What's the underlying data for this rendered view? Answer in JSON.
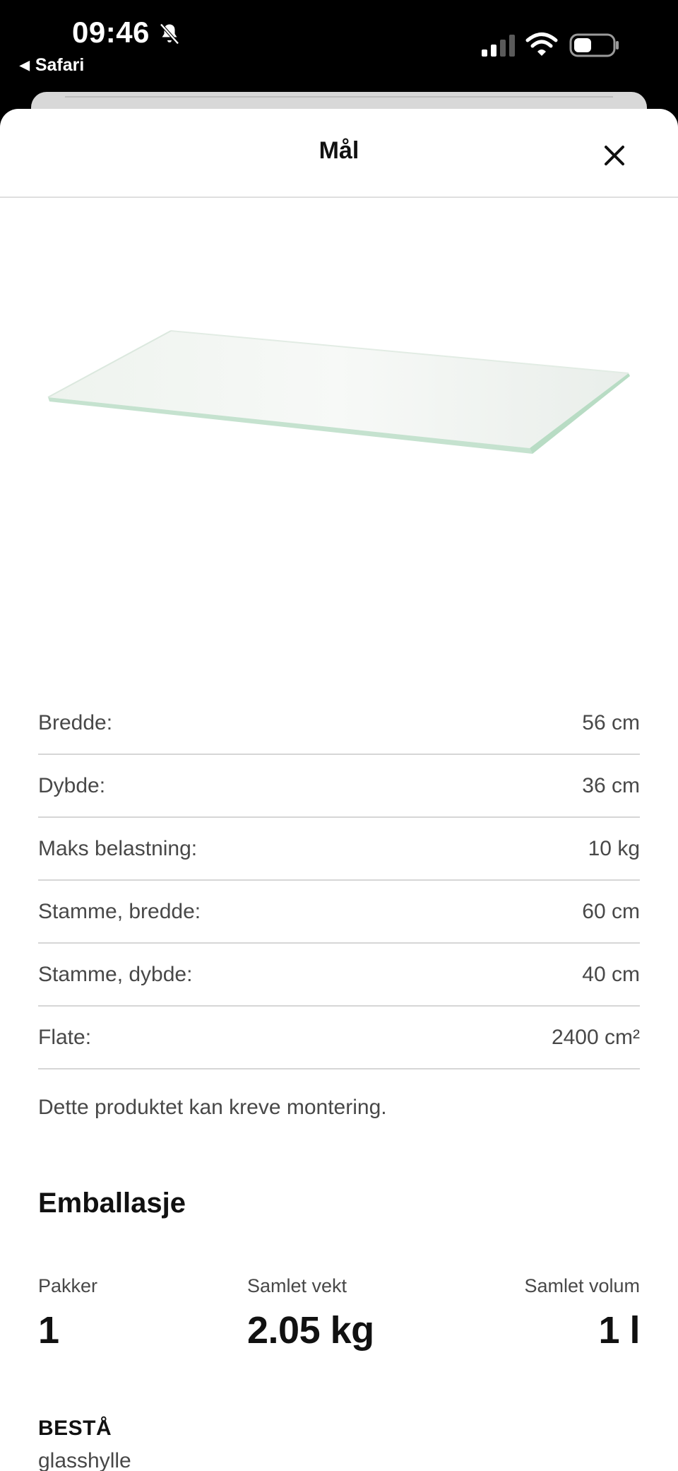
{
  "status_bar": {
    "time": "09:46",
    "back_label": "Safari",
    "icons": [
      "bell-off-icon",
      "signal-icon",
      "wifi-icon",
      "battery-icon"
    ]
  },
  "sheet": {
    "title": "Mål",
    "close_icon": "close-icon",
    "dimensions": [
      {
        "label": "Bredde:",
        "value": "56 cm"
      },
      {
        "label": "Dybde:",
        "value": "36 cm"
      },
      {
        "label": "Maks belastning:",
        "value": "10 kg"
      },
      {
        "label": "Stamme, bredde:",
        "value": "60 cm"
      },
      {
        "label": "Stamme, dybde:",
        "value": "40 cm"
      },
      {
        "label": "Flate:",
        "value": "2400 cm²"
      }
    ],
    "assembly_note": "Dette produktet kan kreve montering.",
    "packaging": {
      "title": "Emballasje",
      "packages_label": "Pakker",
      "packages_value": "1",
      "weight_label": "Samlet vekt",
      "weight_value": "2.05 kg",
      "volume_label": "Samlet volum",
      "volume_value": "1 l"
    },
    "product": {
      "name": "BESTÅ",
      "description": "glasshylle"
    }
  },
  "colors": {
    "text_primary": "#111111",
    "text_secondary": "#484848",
    "divider": "#d6d6d6",
    "glass_edge": "#b8dcc4"
  }
}
